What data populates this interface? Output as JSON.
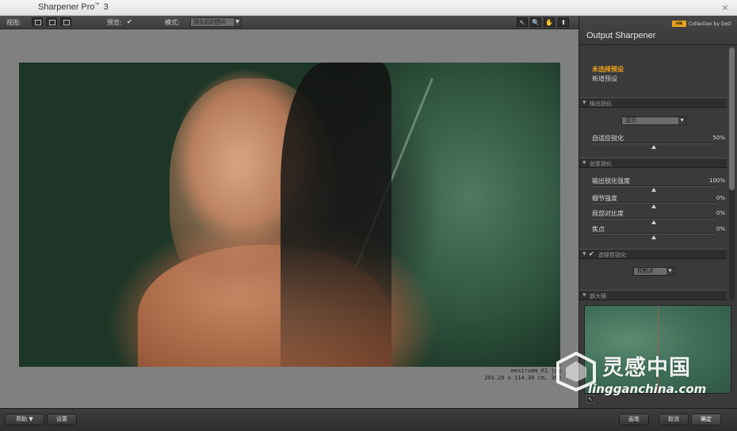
{
  "window": {
    "title": "Sharpener Pro",
    "trademark": "™",
    "version": "3",
    "close_icon": "×"
  },
  "toolbar": {
    "view_label": "视图:",
    "preview_label": "预览:",
    "preview_check": "✔",
    "mode_label": "模式:",
    "mode_value": "锐化后的图片",
    "tools": [
      "↖",
      "🔍",
      "✋",
      "⬆"
    ]
  },
  "image": {
    "filename": "mexirumm_61.jpg",
    "dimensions": "203.20 x 114.30 cm, 300"
  },
  "panel": {
    "brand_logo": "nik",
    "collection_text": "Collection by DxO",
    "title": "Output Sharpener",
    "preset_active": "未选择预设",
    "preset_new": "新增预设",
    "section1": {
      "label": "输出锐化",
      "select_value": "显示",
      "slider_label": "自适应锐化",
      "slider_value": "50%",
      "slider_level": 0.5
    },
    "section2": {
      "label": "创意锐化",
      "sliders": [
        {
          "label": "输出锐化强度",
          "value": "100%",
          "level": 0.5
        },
        {
          "label": "细节强度",
          "value": "0%",
          "level": 0.5
        },
        {
          "label": "局部对比度",
          "value": "0%",
          "level": 0.5
        },
        {
          "label": "焦点",
          "value": "0%",
          "level": 0.5
        }
      ]
    },
    "section3": {
      "label": "选择性锐化",
      "check": "✔",
      "select_value": "控制点"
    },
    "section4": {
      "label": "放大镜"
    },
    "loupe_button_icon": "↖"
  },
  "bottom": {
    "help_label": "帮助 ▼",
    "settings_label": "设置",
    "brush_label": "画笔",
    "cancel_label": "取消",
    "ok_label": "确定"
  },
  "watermark": {
    "cn": "灵感中国",
    "en": "lingganchina.com"
  },
  "colors": {
    "accent": "#f0a21c",
    "logo": "#e5a21a"
  }
}
